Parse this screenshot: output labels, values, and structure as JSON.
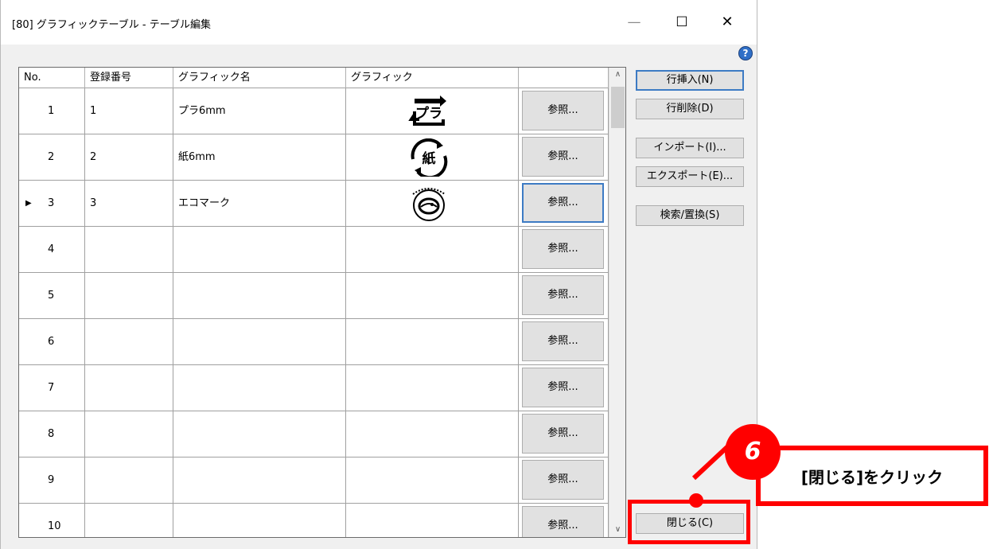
{
  "window": {
    "title": "[80] グラフィックテーブル - テーブル編集",
    "minimize_icon": "—",
    "maximize_icon": "☐",
    "close_icon": "✕",
    "help_icon": "?"
  },
  "table": {
    "headers": [
      "No.",
      "登録番号",
      "グラフィック名",
      "グラフィック",
      ""
    ],
    "rows": [
      {
        "no": "1",
        "reg": "1",
        "name": "プラ6mm",
        "graphic": "pla-recycle-mark",
        "button": "参照..."
      },
      {
        "no": "2",
        "reg": "2",
        "name": "紙6mm",
        "graphic": "paper-recycle-mark",
        "button": "参照..."
      },
      {
        "no": "3",
        "reg": "3",
        "name": "エコマーク",
        "graphic": "eco-mark",
        "button": "参照...",
        "current": true
      },
      {
        "no": "4",
        "reg": "",
        "name": "",
        "graphic": "",
        "button": "参照..."
      },
      {
        "no": "5",
        "reg": "",
        "name": "",
        "graphic": "",
        "button": "参照..."
      },
      {
        "no": "6",
        "reg": "",
        "name": "",
        "graphic": "",
        "button": "参照..."
      },
      {
        "no": "7",
        "reg": "",
        "name": "",
        "graphic": "",
        "button": "参照..."
      },
      {
        "no": "8",
        "reg": "",
        "name": "",
        "graphic": "",
        "button": "参照..."
      },
      {
        "no": "9",
        "reg": "",
        "name": "",
        "graphic": "",
        "button": "参照..."
      },
      {
        "no": "10",
        "reg": "",
        "name": "",
        "graphic": "",
        "button": "参照..."
      }
    ],
    "current_row_marker": "▶",
    "scroll_up_icon": "∧",
    "scroll_down_icon": "∨",
    "pla_label": "プラ",
    "paper_label": "紙"
  },
  "buttons": {
    "insert_row": "行挿入(N)",
    "delete_row": "行削除(D)",
    "import": "インポート(I)...",
    "export": "エクスポート(E)...",
    "search_replace": "検索/置換(S)",
    "close": "閉じる(C)"
  },
  "annotation": {
    "step_number": "6",
    "text": "[閉じる]をクリック",
    "color": "#ff0000"
  }
}
